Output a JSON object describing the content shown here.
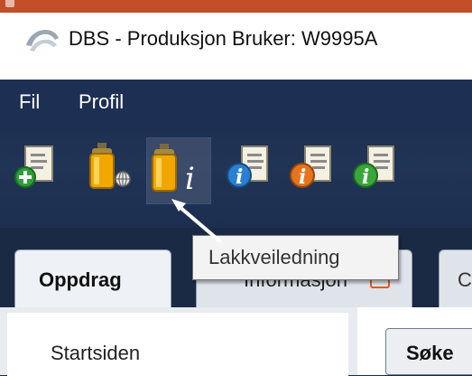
{
  "window": {
    "title": "DBS - Produksjon Bruker: W9995A"
  },
  "menu": {
    "items": [
      {
        "label": "Fil"
      },
      {
        "label": "Profil"
      }
    ]
  },
  "toolbar": {
    "buttons": [
      {
        "icon": "add-document-icon"
      },
      {
        "icon": "spray-can-globe-icon"
      },
      {
        "icon": "spray-can-info-icon",
        "hovered": true
      },
      {
        "icon": "blue-info-document-icon"
      },
      {
        "icon": "orange-info-document-icon"
      },
      {
        "icon": "green-info-document-icon"
      }
    ]
  },
  "tooltip": {
    "text": "Lakkveiledning"
  },
  "tabs": [
    {
      "label": "Oppdrag",
      "active": true
    },
    {
      "label": "Informasjon"
    },
    {
      "label": "C"
    }
  ],
  "sidebar": {
    "items": [
      {
        "label": "Startsiden"
      }
    ]
  },
  "main": {
    "search_label": "Søke"
  },
  "colors": {
    "menubar": "#1d2f52",
    "titlebar_accent": "#c24e2a",
    "tab_close_accent": "#e05a20"
  }
}
